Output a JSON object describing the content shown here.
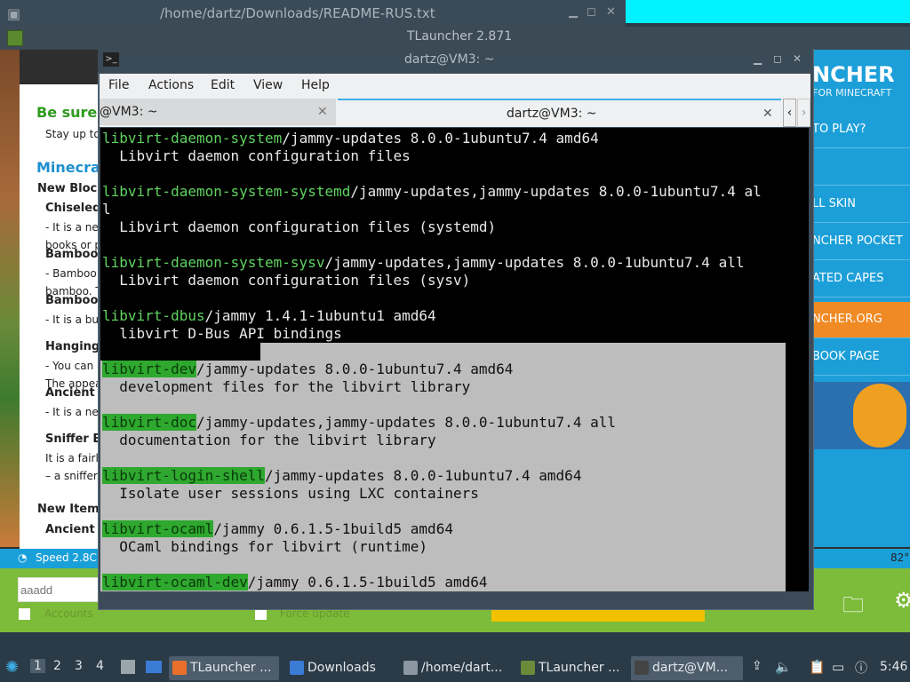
{
  "bg_window": {
    "title": "/home/dartz/Downloads/README-RUS.txt"
  },
  "tlauncher": {
    "title": "TLauncher 2.871",
    "news": {
      "headline": "Be sure t",
      "stay": "Stay up to",
      "section": "Minecrat",
      "new_blocks": "New Blocks",
      "items": [
        {
          "h": "Chiseled",
          "t1": "- It is a new",
          "t2": "books or p"
        },
        {
          "h": "Bamboo P",
          "t1": "- Bamboo p",
          "t2": "bamboo. T"
        },
        {
          "h": "Bamboo M",
          "t1": "- It is a buil",
          "t2": ""
        },
        {
          "h": "Hanging S",
          "t1": "- You can le",
          "t2": "The appear"
        },
        {
          "h": "Ancient P",
          "t1": "- It is a new",
          "t2": ""
        },
        {
          "h": "Sniffer Eg",
          "t1": "It is a fairly",
          "t2": "– a sniffer."
        }
      ],
      "new_items": "New Items",
      "ancient_s": "Ancient S"
    },
    "brand": {
      "name": "NCHER",
      "sub": "FOR MINECRAFT"
    },
    "menu": [
      {
        "label": "TO PLAY?",
        "hl": false
      },
      {
        "label": "",
        "hl": false
      },
      {
        "label": "LL SKIN",
        "hl": false
      },
      {
        "label": "NCHER POCKET",
        "hl": false
      },
      {
        "label": "ATED CAPES",
        "hl": false
      },
      {
        "label": "NCHER.ORG",
        "hl": true
      },
      {
        "label": "BOOK PAGE",
        "hl": false
      }
    ],
    "status": {
      "speed": "Speed 2.8C",
      "percent": "82°"
    },
    "bottom": {
      "account_placeholder": "aaadd",
      "accounts": "Accounts",
      "force_update": "Force update"
    }
  },
  "terminal": {
    "title": "dartz@VM3: ~",
    "menu": [
      "File",
      "Edit",
      "View",
      "Help",
      "Actions"
    ],
    "tabs": [
      {
        "label": "@VM3: ~",
        "active": false
      },
      {
        "label": "dartz@VM3: ~",
        "active": true
      }
    ],
    "lines": [
      {
        "pkg": "libvirt-daemon-system",
        "rest": "/jammy-updates 8.0.0-1ubuntu7.4 amd64",
        "hl": false
      },
      {
        "pkg": "",
        "rest": "  Libvirt daemon configuration files",
        "hl": false
      },
      {
        "pkg": "",
        "rest": "",
        "hl": false
      },
      {
        "pkg": "libvirt-daemon-system-systemd",
        "rest": "/jammy-updates,jammy-updates 8.0.0-1ubuntu7.4 al",
        "hl": false
      },
      {
        "pkg": "",
        "rest": "l",
        "hl": false
      },
      {
        "pkg": "",
        "rest": "  Libvirt daemon configuration files (systemd)",
        "hl": false
      },
      {
        "pkg": "",
        "rest": "",
        "hl": false
      },
      {
        "pkg": "libvirt-daemon-system-sysv",
        "rest": "/jammy-updates,jammy-updates 8.0.0-1ubuntu7.4 all",
        "hl": false
      },
      {
        "pkg": "",
        "rest": "  Libvirt daemon configuration files (sysv)",
        "hl": false
      },
      {
        "pkg": "",
        "rest": "",
        "hl": false
      },
      {
        "pkg": "libvirt-dbus",
        "rest": "/jammy 1.4.1-1ubuntu1 amd64",
        "hl": false
      },
      {
        "pkg": "",
        "rest": "  libvirt D-Bus API bindings",
        "hl": false
      },
      {
        "pkg": "",
        "rest": "",
        "hl": false
      },
      {
        "pkg": "libvirt-dev",
        "rest": "/jammy-updates 8.0.0-1ubuntu7.4 amd64",
        "hl": true
      },
      {
        "pkg": "",
        "rest": "  development files for the libvirt library",
        "hl": true
      },
      {
        "pkg": "",
        "rest": "",
        "hl": true
      },
      {
        "pkg": "libvirt-doc",
        "rest": "/jammy-updates,jammy-updates 8.0.0-1ubuntu7.4 all",
        "hl": true
      },
      {
        "pkg": "",
        "rest": "  documentation for the libvirt library",
        "hl": true
      },
      {
        "pkg": "",
        "rest": "",
        "hl": true
      },
      {
        "pkg": "libvirt-login-shell",
        "rest": "/jammy-updates 8.0.0-1ubuntu7.4 amd64",
        "hl": true
      },
      {
        "pkg": "",
        "rest": "  Isolate user sessions using LXC containers",
        "hl": true
      },
      {
        "pkg": "",
        "rest": "",
        "hl": true
      },
      {
        "pkg": "libvirt-ocaml",
        "rest": "/jammy 0.6.1.5-1build5 amd64",
        "hl": true
      },
      {
        "pkg": "",
        "rest": "  OCaml bindings for libvirt (runtime)",
        "hl": true
      },
      {
        "pkg": "",
        "rest": "",
        "hl": true
      },
      {
        "pkg": "libvirt-ocaml-dev",
        "rest": "/jammy 0.6.1.5-1build5 amd64",
        "hl": true
      }
    ]
  },
  "panel": {
    "workspaces": [
      "1",
      "2",
      "3",
      "4"
    ],
    "tasks": [
      {
        "label": "TLauncher ...",
        "active": true,
        "color": "#e8702a"
      },
      {
        "label": "Downloads",
        "active": false,
        "color": "#3a7bd5"
      },
      {
        "label": "/home/dart...",
        "active": false,
        "color": "#8a97a3"
      },
      {
        "label": "TLauncher ...",
        "active": false,
        "color": "#6b8a3a"
      },
      {
        "label": "dartz@VM...",
        "active": true,
        "color": "#444"
      }
    ],
    "clock": "5:46"
  }
}
